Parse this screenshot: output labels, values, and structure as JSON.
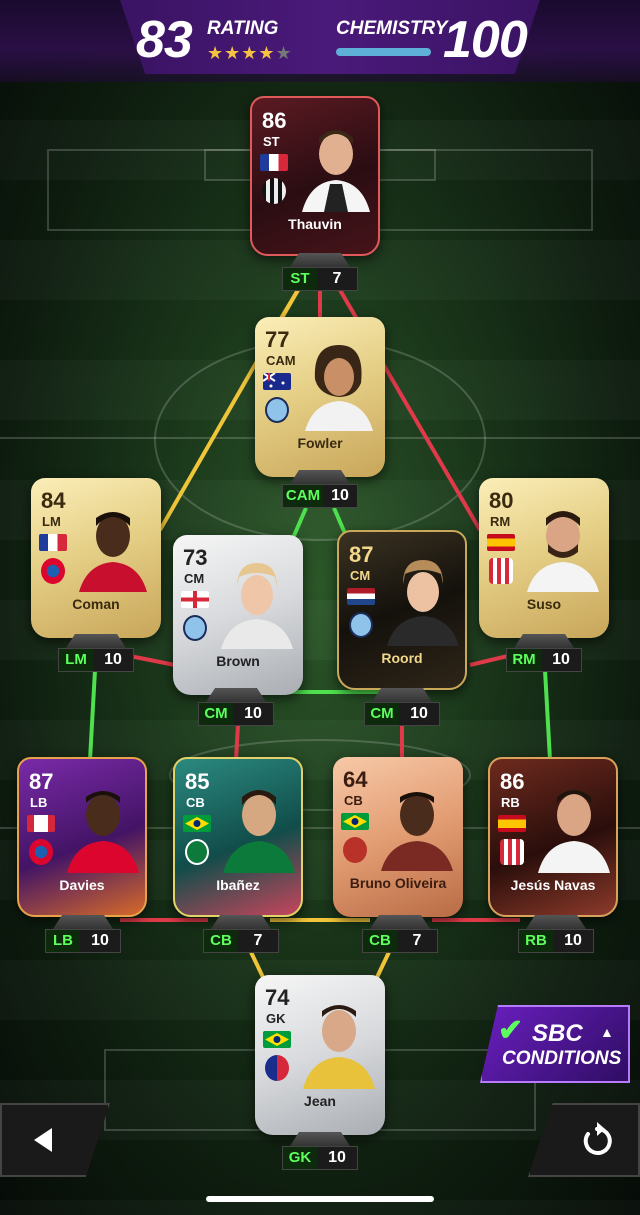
{
  "header": {
    "rating_value": "83",
    "rating_label": "RATING",
    "stars_on": "★★★★",
    "stars_off": "★",
    "chemistry_label": "CHEMISTRY",
    "chemistry_value": "100",
    "star_rating": 4
  },
  "players": {
    "st": {
      "ovr": "86",
      "pos": "ST",
      "name": "Thauvin",
      "chem_pos": "ST",
      "chem": "7",
      "flag": "france",
      "club": "udinese"
    },
    "cam": {
      "ovr": "77",
      "pos": "CAM",
      "name": "Fowler",
      "chem_pos": "CAM",
      "chem": "10",
      "flag": "australia",
      "club": "man-city"
    },
    "lm": {
      "ovr": "84",
      "pos": "LM",
      "name": "Coman",
      "chem_pos": "LM",
      "chem": "10",
      "flag": "france",
      "club": "bayern"
    },
    "rm": {
      "ovr": "80",
      "pos": "RM",
      "name": "Suso",
      "chem_pos": "RM",
      "chem": "10",
      "flag": "spain",
      "club": "sevilla"
    },
    "cm1": {
      "ovr": "73",
      "pos": "CM",
      "name": "Brown",
      "chem_pos": "CM",
      "chem": "10",
      "flag": "england",
      "club": "man-city"
    },
    "cm2": {
      "ovr": "87",
      "pos": "CM",
      "name": "Roord",
      "chem_pos": "CM",
      "chem": "10",
      "flag": "netherlands",
      "club": "man-city"
    },
    "lb": {
      "ovr": "87",
      "pos": "LB",
      "name": "Davies",
      "chem_pos": "LB",
      "chem": "10",
      "flag": "canada",
      "club": "bayern"
    },
    "cb1": {
      "ovr": "85",
      "pos": "CB",
      "name": "Ibañez",
      "chem_pos": "CB",
      "chem": "7",
      "flag": "brazil",
      "club": "al-ahli"
    },
    "cb2": {
      "ovr": "64",
      "pos": "CB",
      "name": "Bruno Oliveira",
      "chem_pos": "CB",
      "chem": "7",
      "flag": "brazil",
      "club": "club-crest"
    },
    "rb": {
      "ovr": "86",
      "pos": "RB",
      "name": "Jesús Navas",
      "chem_pos": "RB",
      "chem": "10",
      "flag": "spain",
      "club": "sevilla"
    },
    "gk": {
      "ovr": "74",
      "pos": "GK",
      "name": "Jean",
      "chem_pos": "GK",
      "chem": "10",
      "flag": "brazil",
      "club": "cerro-porteno"
    }
  },
  "sbc": {
    "line1": "SBC",
    "line2": "CONDITIONS",
    "check_icon": "check-icon",
    "caret_icon": "caret-up-icon"
  },
  "nav": {
    "back_icon": "back-arrow-icon",
    "undo_icon": "undo-icon"
  },
  "colors": {
    "link_green": "#4ee04e",
    "link_yellow": "#f0c53a",
    "link_red": "#e03a4a",
    "chem_green": "#5cff5c",
    "chem_bar": "#5fb0d8"
  }
}
